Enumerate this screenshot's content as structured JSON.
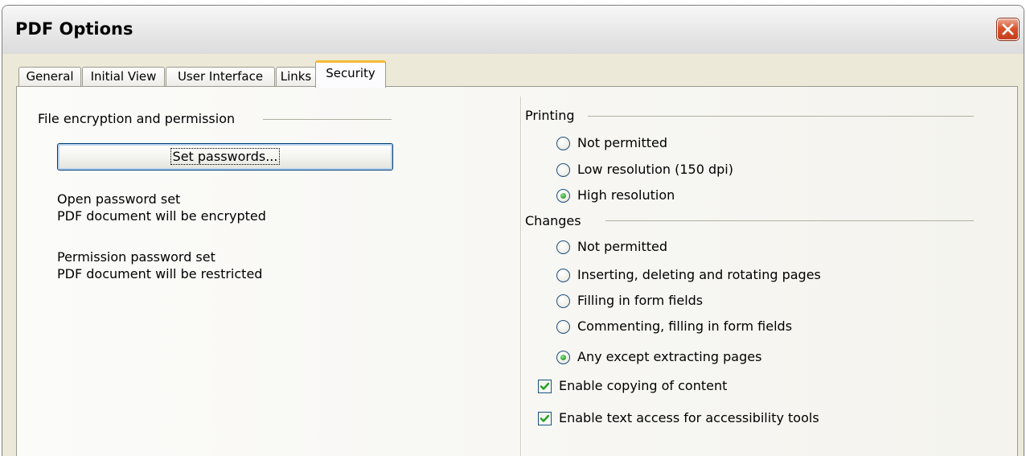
{
  "window": {
    "title": "PDF Options"
  },
  "tabs": [
    {
      "label": "General"
    },
    {
      "label": "Initial View"
    },
    {
      "label": "User Interface"
    },
    {
      "label": "Links"
    },
    {
      "label": "Security",
      "active": true
    }
  ],
  "left": {
    "section_title": "File encryption and permission",
    "set_passwords_button": "Set passwords...",
    "status": [
      "Open password set",
      "PDF document will be encrypted",
      "Permission password set",
      "PDF document will be restricted"
    ]
  },
  "printing": {
    "title": "Printing",
    "options": [
      {
        "label": "Not permitted",
        "selected": false
      },
      {
        "label": "Low resolution (150 dpi)",
        "selected": false
      },
      {
        "label": "High resolution",
        "selected": true
      }
    ]
  },
  "changes": {
    "title": "Changes",
    "options": [
      {
        "label": "Not permitted",
        "selected": false
      },
      {
        "label": "Inserting, deleting and rotating pages",
        "selected": false
      },
      {
        "label": "Filling in form fields",
        "selected": false
      },
      {
        "label": "Commenting, filling in form fields",
        "selected": false
      },
      {
        "label": "Any except extracting pages",
        "selected": true
      }
    ]
  },
  "checkboxes": [
    {
      "label": "Enable copying of content",
      "checked": true
    },
    {
      "label": "Enable text access for accessibility tools",
      "checked": true
    }
  ],
  "colors": {
    "close_button": "#d9532d",
    "active_tab_accent": "#f6b836",
    "radio_dot": "#2ea02e",
    "check_mark": "#22a022",
    "control_border": "#1c5180"
  },
  "icons": [
    "close-icon",
    "checkmark-icon"
  ]
}
